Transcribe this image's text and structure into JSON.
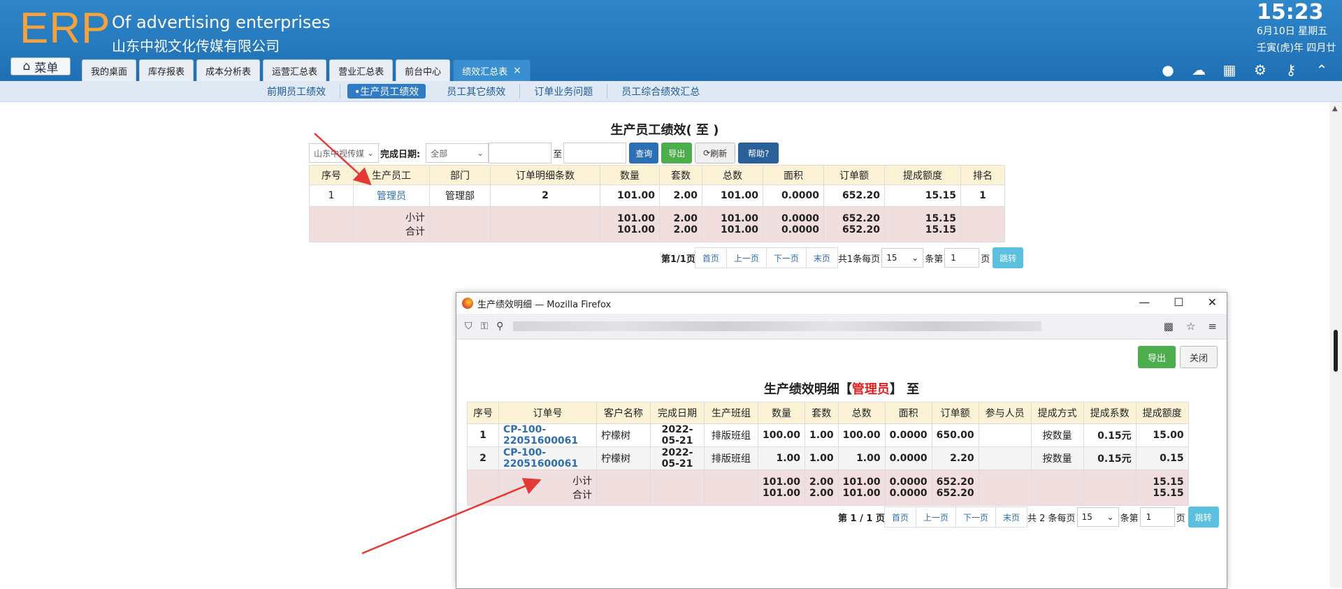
{
  "header": {
    "logo": "ERP",
    "title": "Of advertising enterprises",
    "subtitle": "山东中视文化传媒有限公司",
    "clock": "15:23",
    "date_line1": "6月10日 星期五",
    "date_line2": "壬寅(虎)年 四月廿",
    "menu_label": "菜单",
    "tabs": [
      {
        "label": "我的桌面"
      },
      {
        "label": "库存报表"
      },
      {
        "label": "成本分析表"
      },
      {
        "label": "运营汇总表"
      },
      {
        "label": "营业汇总表"
      },
      {
        "label": "前台中心"
      },
      {
        "label": "绩效汇总表",
        "active": true
      }
    ],
    "tab_close": "×",
    "right_icons": [
      "user-icon",
      "cloud-help-icon",
      "grid-icon",
      "gear-icon",
      "key-icon",
      "collapse-icon"
    ]
  },
  "subnav": {
    "items": [
      {
        "label": "前期员工绩效"
      },
      {
        "label": "•生产员工绩效",
        "active": true
      },
      {
        "label": "员工其它绩效"
      },
      {
        "label": "订单业务问题"
      },
      {
        "label": "员工综合绩效汇总"
      }
    ]
  },
  "main": {
    "title": "生产员工绩效( 至 )",
    "filter": {
      "company_select": "山东中视传媒",
      "date_label": "完成日期:",
      "status_select": "全部",
      "to_label": "至",
      "query_btn": "查询",
      "export_btn": "导出",
      "refresh_btn": "刷新",
      "help_btn": "帮助?"
    },
    "table": {
      "headers": [
        "序号",
        "生产员工",
        "部门",
        "订单明细条数",
        "数量",
        "套数",
        "总数",
        "面积",
        "订单额",
        "提成额度",
        "排名"
      ],
      "rows": [
        [
          "1",
          "管理员",
          "管理部",
          "2",
          "101.00",
          "2.00",
          "101.00",
          "0.0000",
          "652.20",
          "15.15",
          "1"
        ]
      ],
      "subtotal_label": "小计",
      "total_label": "合计",
      "subtotal": [
        "101.00",
        "2.00",
        "101.00",
        "0.0000",
        "652.20",
        "15.15"
      ],
      "total": [
        "101.00",
        "2.00",
        "101.00",
        "0.0000",
        "652.20",
        "15.15"
      ]
    },
    "pager": {
      "page_info": "第1/1页",
      "first": "首页",
      "prev": "上一页",
      "next": "下一页",
      "last": "末页",
      "count_text": "共1条每页",
      "per_page": "15",
      "goto_pre": "条第",
      "page_input": "1",
      "goto_post": "页",
      "go_btn": "跳转"
    }
  },
  "popup": {
    "window_title": "生产绩效明细 — Mozilla Firefox",
    "window_controls": [
      "—",
      "☐",
      "✕"
    ],
    "export_btn": "导出",
    "close_btn": "关闭",
    "title_prefix": "生产绩效明细【",
    "title_name": "管理员",
    "title_suffix": "】 至",
    "table": {
      "headers": [
        "序号",
        "订单号",
        "客户名称",
        "完成日期",
        "生产班组",
        "数量",
        "套数",
        "总数",
        "面积",
        "订单额",
        "参与人员",
        "提成方式",
        "提成系数",
        "提成额度"
      ],
      "rows": [
        [
          "1",
          "CP-100-22051600061",
          "柠檬树",
          "2022-05-21",
          "排版班组",
          "100.00",
          "1.00",
          "100.00",
          "0.0000",
          "650.00",
          "",
          "按数量",
          "0.15元",
          "15.00"
        ],
        [
          "2",
          "CP-100-22051600061",
          "柠檬树",
          "2022-05-21",
          "排版班组",
          "1.00",
          "1.00",
          "1.00",
          "0.0000",
          "2.20",
          "",
          "按数量",
          "0.15元",
          "0.15"
        ]
      ],
      "subtotal_label": "小计",
      "total_label": "合计",
      "subtotal": [
        "101.00",
        "2.00",
        "101.00",
        "0.0000",
        "652.20",
        "15.15"
      ],
      "total": [
        "101.00",
        "2.00",
        "101.00",
        "0.0000",
        "652.20",
        "15.15"
      ]
    },
    "pager": {
      "page_info": "第 1 / 1 页",
      "first": "首页",
      "prev": "上一页",
      "next": "下一页",
      "last": "末页",
      "count_text": "共 2 条每页",
      "per_page": "15",
      "goto_pre": "条第",
      "page_input": "1",
      "goto_post": "页",
      "go_btn": "跳转"
    }
  },
  "colors": {
    "header_blue": "#1f6fb4",
    "logo_orange": "#f5a23a",
    "annotation_red": "#e53935"
  }
}
